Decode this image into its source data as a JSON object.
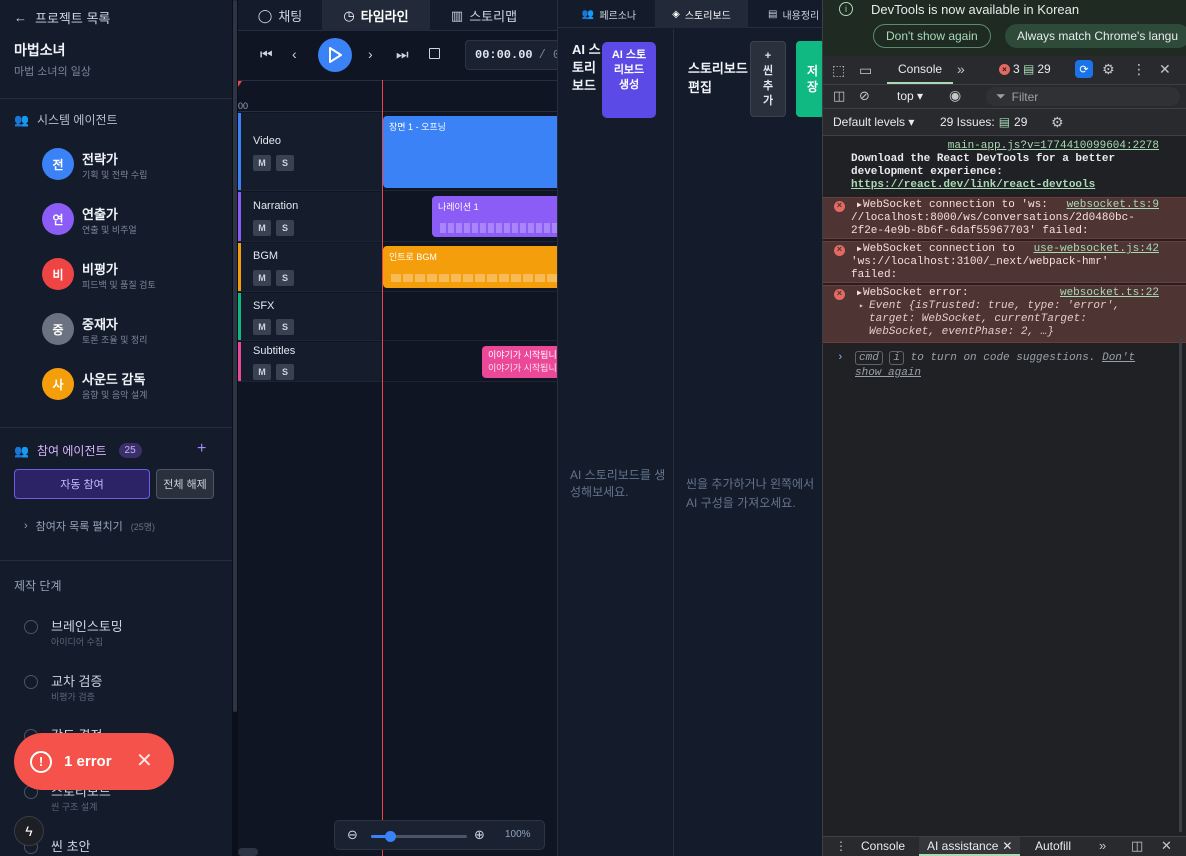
{
  "sidebar": {
    "back_label": "프로젝트 목록",
    "project_title": "마법소녀",
    "project_subtitle": "마법 소녀의 일상",
    "system_agents_title": "시스템 에이전트",
    "system_agents": [
      {
        "initial": "전",
        "name": "전략가",
        "desc": "기획 및 전략 수립",
        "color": "#3b82f6"
      },
      {
        "initial": "연",
        "name": "연출가",
        "desc": "연출 및 비주얼",
        "color": "#8b5cf6"
      },
      {
        "initial": "비",
        "name": "비평가",
        "desc": "피드백 및 품질 검토",
        "color": "#ef4444"
      },
      {
        "initial": "중",
        "name": "중재자",
        "desc": "토론 조율 및 정리",
        "color": "#6b7280"
      },
      {
        "initial": "사",
        "name": "사운드 감독",
        "desc": "음향 및 음악 설계",
        "color": "#f59e0b"
      }
    ],
    "participants_title": "참여 에이전트",
    "participants_count": "25",
    "auto_join_label": "자동 참여",
    "clear_all_label": "전체 해제",
    "expand_list_label": "참여자 목록 펼치기",
    "expand_list_count": "(25명)",
    "stages_title": "제작 단계",
    "stages": [
      {
        "name": "브레인스토밍",
        "desc": "아이디어 수집"
      },
      {
        "name": "교차 검증",
        "desc": "비평가 검증"
      },
      {
        "name": "각도 결정",
        "desc": ""
      },
      {
        "name": "스토리보드",
        "desc": "씬 구조 설계"
      },
      {
        "name": "씬 초안",
        "desc": ""
      }
    ]
  },
  "timeline": {
    "tabs": [
      "채팅",
      "타임라인",
      "스토리맵"
    ],
    "active_tab": "타임라인",
    "time_display": "00:00.00",
    "time_sep": "/ 0",
    "ruler_start": "00",
    "tracks": [
      {
        "name": "Video",
        "color": "#3b82f6"
      },
      {
        "name": "Narration",
        "color": "#8b5cf6"
      },
      {
        "name": "BGM",
        "color": "#f59e0b"
      },
      {
        "name": "SFX",
        "color": "#10b981"
      },
      {
        "name": "Subtitles",
        "color": "#ec4899"
      }
    ],
    "mute_label": "M",
    "solo_label": "S",
    "clips": {
      "video": "장면 1 - 오프닝",
      "narration": "나레이션 1",
      "bgm": "인트로 BGM",
      "subtitle_1": "이야기가 시작됩니다",
      "subtitle_2": "이야기가 시작됩니다"
    },
    "zoom_level": "100%",
    "zoom_fraction": 0.2
  },
  "storyboard": {
    "tabs": [
      "페르소나",
      "스토리보드",
      "내용정리"
    ],
    "active_tab": "스토리보드",
    "ai_storyboard_title": "AI 스토리보드",
    "ai_generate_button": "AI 스토리보드 생성",
    "edit_title": "스토리보드 편집",
    "add_scene_button": "+ 씬 추가",
    "save_button": "저장",
    "ai_empty_text": "AI 스토리보드를 생성해보세요.",
    "edit_empty_text": "씬을 추가하거나 왼쪽에서 AI 구성을 가져오세요."
  },
  "devtools": {
    "info_text": "DevTools is now available in Korean",
    "dont_show_button": "Don't show again",
    "match_language_button": "Always match Chrome's langu",
    "console_tab": "Console",
    "error_count": "3",
    "warning_count": "29",
    "context_label": "top",
    "filter_placeholder": "Filter",
    "levels_label": "Default levels",
    "issues_label": "29 Issues:",
    "issues_count": "29",
    "messages": [
      {
        "type": "info",
        "source": "main-app.js?v=1774410099604:2278",
        "text": "Download the React DevTools for a better development experience:",
        "link": "https://react.dev/link/react-devtools"
      },
      {
        "type": "error",
        "text_a": "WebSocket connection to 'ws:",
        "source": "websocket.ts:9",
        "text_b": "//localhost:8000/ws/conversations/2d0480bc-2f2e-4e9b-8b6f-6daf55967703' failed:"
      },
      {
        "type": "error",
        "text_a": "WebSocket connection to",
        "source": "use-websocket.js:42",
        "text_b": "'ws://localhost:3100/_next/webpack-hmr' failed:"
      },
      {
        "type": "error",
        "text_a": "WebSocket error:",
        "source": "websocket.ts:22",
        "text_b": "Event {isTrusted: true, type: 'error', target: WebSocket, currentTarget: WebSocket, eventPhase: 2, …}"
      }
    ],
    "prompt_hint_a": "cmd",
    "prompt_hint_b": "i",
    "prompt_hint_c": "to turn on code suggestions.",
    "prompt_hint_link": "Don't show again",
    "drawer_tabs": [
      "Console",
      "AI assistance",
      "Autofill"
    ]
  },
  "toast": {
    "label": "1 error"
  },
  "colors": {
    "accent": "#3b82f6",
    "error": "#f4524a",
    "purple": "#6d5ce7"
  }
}
